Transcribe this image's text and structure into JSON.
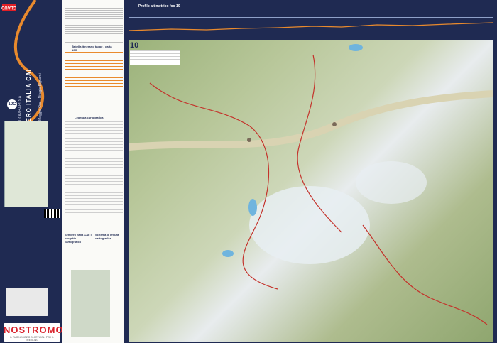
{
  "cover": {
    "logo": "CLAUD",
    "title": "SENTIERO ITALIA CAI",
    "region": "LOMBARDIA",
    "subtitle": "Magg.o Orsi · Rifugio Bignami",
    "badge": "10C",
    "publisher_brand": "NOSTROMO",
    "publisher_tag": "IL TUO NEGOZIO DI ARTICOLI PER IL TREKKING"
  },
  "info": {
    "table_title": "Tabella itinerario tappe - carta 10C",
    "legend_title": "Legenda cartografica",
    "scheme_title_1": "Sentiero Italia CAI: il progetto cartografico",
    "scheme_title_2": "Schema di lettura cartografica"
  },
  "map": {
    "profile_title": "Profilo altimetrico foo 10",
    "sheet_number": "10",
    "colors": {
      "navy": "#1f2a52",
      "accent_red": "#e11f26",
      "trail_orange": "#e98a2d",
      "route_red": "#c4322b",
      "glacier": "#e8eef2",
      "forest": "#8fa66f",
      "meadow": "#cdd7b8"
    },
    "routes": [
      "trail"
    ],
    "lakes": [
      "lake"
    ],
    "icons": [
      "peak-icon",
      "hut-icon",
      "town-icon"
    ]
  }
}
